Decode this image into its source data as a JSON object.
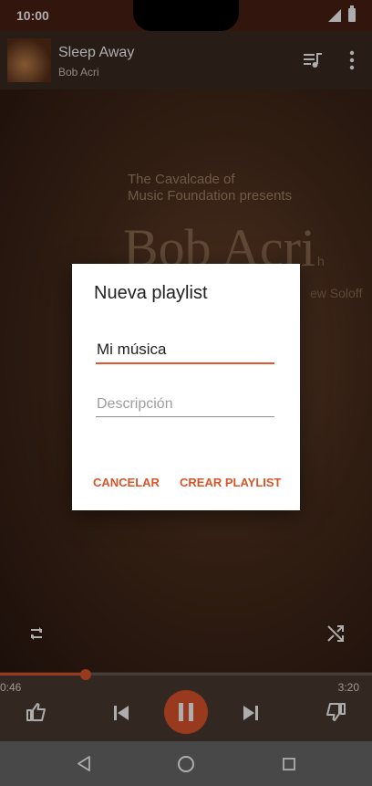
{
  "status_bar": {
    "time": "10:00"
  },
  "now_playing": {
    "title": "Sleep Away",
    "artist": "Bob Acri"
  },
  "album_art": {
    "line1": "The Cavalcade of",
    "line2": "Music Foundation presents",
    "artist_big": "Bob Acri",
    "small_text": "ew Soloff",
    "small_text2": "h"
  },
  "player": {
    "elapsed": "0:46",
    "total": "3:20",
    "progress": 0.23
  },
  "dialog": {
    "title": "Nueva playlist",
    "name_value": "Mi música",
    "description_placeholder": "Descripción",
    "cancel_label": "CANCELAR",
    "create_label": "CREAR PLAYLIST"
  },
  "colors": {
    "accent": "#e2542c",
    "dialog_button": "#d85529"
  },
  "icons": [
    "queue-music-icon",
    "more-vert-icon",
    "repeat-icon",
    "shuffle-icon",
    "thumbs-up-icon",
    "skip-previous-icon",
    "pause-icon",
    "skip-next-icon",
    "thumbs-down-icon",
    "back-icon",
    "home-icon",
    "recents-icon",
    "signal-icon",
    "battery-icon"
  ]
}
